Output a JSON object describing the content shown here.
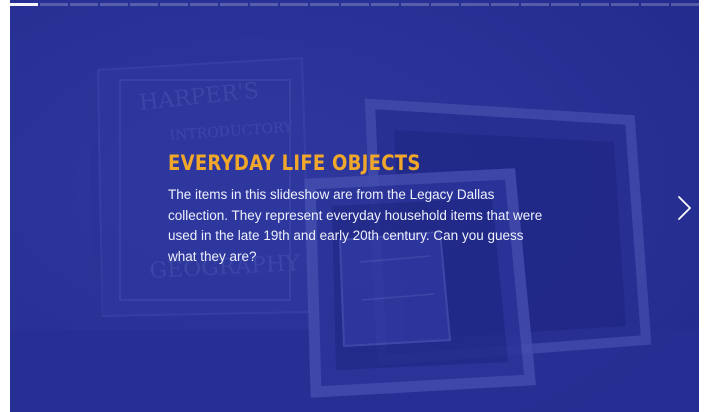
{
  "slide": {
    "title": "EVERYDAY LIFE OBJECTS",
    "body": "The items in this slideshow are from the Legacy Dallas collection. They represent everyday household items that were used in the late 19th and early 20th century. Can you guess what they are?"
  },
  "progress": {
    "total_slides": 23,
    "current_slide": 1
  },
  "controls": {
    "next_icon": "chevron-right-icon"
  },
  "colors": {
    "background_tint": "#2a3398",
    "title": "#f0a72a",
    "body_text": "#eef0fb"
  }
}
